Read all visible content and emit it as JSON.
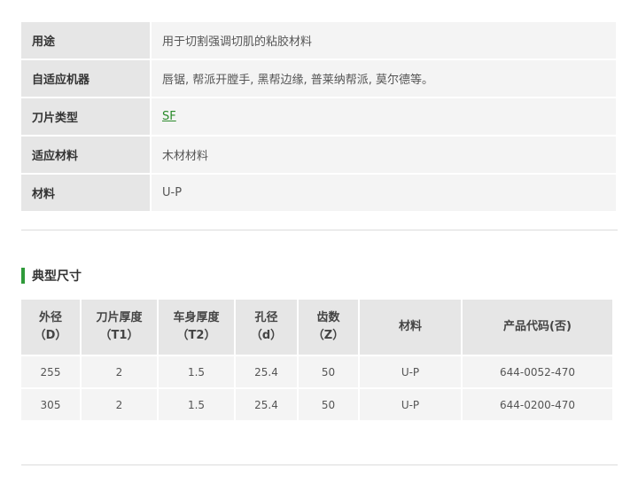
{
  "specs": [
    {
      "label": "用途",
      "value": "用于切割强调切肌的粘胶材料"
    },
    {
      "label": "自适应机器",
      "value": "唇锯, 帮派开膛手, 黑帮边缘, 普莱纳帮派, 莫尔德等。"
    },
    {
      "label": "刀片类型",
      "value": "SF"
    },
    {
      "label": "适应材料",
      "value": "木材材料"
    },
    {
      "label": "材料",
      "value": "U-P"
    }
  ],
  "section_title": "典型尺寸",
  "dimensions": {
    "headers": [
      {
        "line1": "外径",
        "line2": "（D）"
      },
      {
        "line1": "刀片厚度",
        "line2": "（T1）"
      },
      {
        "line1": "车身厚度",
        "line2": "（T2）"
      },
      {
        "line1": "孔径",
        "line2": "（d）"
      },
      {
        "line1": "齿数",
        "line2": "（Z）"
      },
      {
        "line1": "材料",
        "line2": ""
      },
      {
        "line1": "产品代码(否)",
        "line2": ""
      }
    ],
    "rows": [
      [
        "255",
        "2",
        "1.5",
        "25.4",
        "50",
        "U-P",
        "644-0052-470"
      ],
      [
        "305",
        "2",
        "1.5",
        "25.4",
        "50",
        "U-P",
        "644-0200-470"
      ]
    ]
  }
}
